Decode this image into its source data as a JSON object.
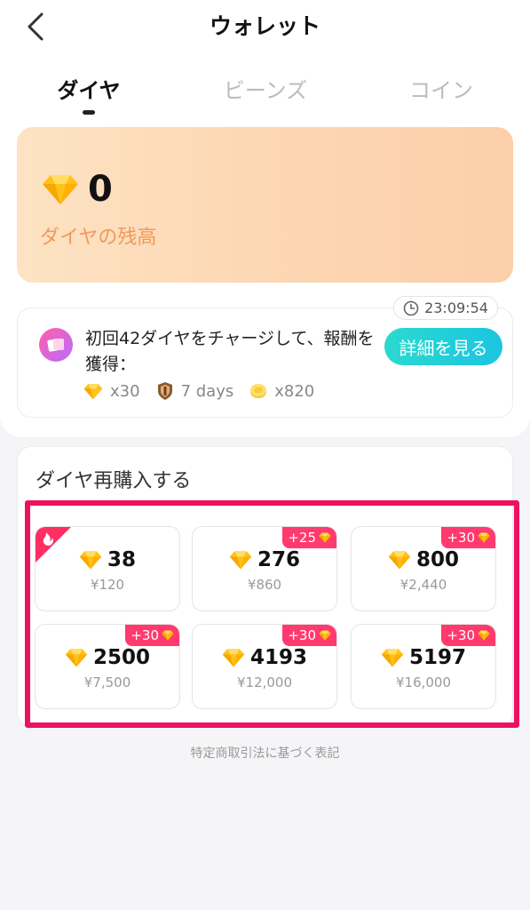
{
  "header": {
    "title": "ウォレット",
    "back_icon": "chevron-left-icon"
  },
  "tabs": [
    {
      "label": "ダイヤ",
      "active": true
    },
    {
      "label": "ビーンズ",
      "active": false
    },
    {
      "label": "コイン",
      "active": false
    }
  ],
  "balance": {
    "value": "0",
    "label": "ダイヤの残高",
    "icon": "diamond-icon"
  },
  "promo": {
    "timer": "23:09:54",
    "text": "初回42ダイヤをチャージして、報酬を獲得：",
    "button_label": "詳細を見る",
    "rewards": [
      {
        "icon": "diamond-icon",
        "label": "x30"
      },
      {
        "icon": "shield-badge-icon",
        "label": "7 days"
      },
      {
        "icon": "coin-icon",
        "label": "x820"
      }
    ]
  },
  "purchase": {
    "title": "ダイヤ再購入する",
    "packages": [
      {
        "amount": "38",
        "price": "¥120",
        "bonus": "",
        "hot": true
      },
      {
        "amount": "276",
        "price": "¥860",
        "bonus": "+25",
        "hot": false
      },
      {
        "amount": "800",
        "price": "¥2,440",
        "bonus": "+30",
        "hot": false
      },
      {
        "amount": "2500",
        "price": "¥7,500",
        "bonus": "+30",
        "hot": false
      },
      {
        "amount": "4193",
        "price": "¥12,000",
        "bonus": "+30",
        "hot": false
      },
      {
        "amount": "5197",
        "price": "¥16,000",
        "bonus": "+30",
        "hot": false
      }
    ]
  },
  "footer": {
    "link_label": "特定商取引法に基づく表記"
  },
  "colors": {
    "accent_teal": "#1bc5e0",
    "highlight_pink": "#ee1160",
    "bonus_pink": "#ff3a6e",
    "balance_label_orange": "#f09a5a",
    "diamond_yellow": "#ffc21a"
  }
}
